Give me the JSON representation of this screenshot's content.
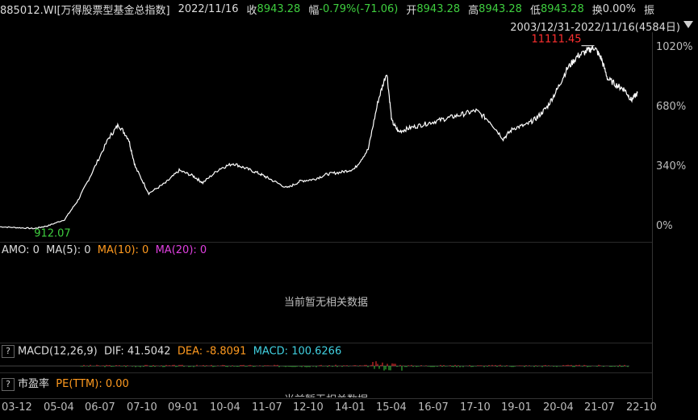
{
  "header": {
    "code_name": "885012.WI[万得股票型基金总指数]",
    "date": "2022/11/16",
    "close_label": "收",
    "close_value": "8943.28",
    "change_label": "幅",
    "change_value": "-0.79%(-71.06)",
    "open_label": "开",
    "open_value": "8943.28",
    "high_label": "高",
    "high_value": "8943.28",
    "low_label": "低",
    "low_value": "8943.28",
    "turnover_label": "换",
    "turnover_value": "0.00%",
    "amplitude_label": "振"
  },
  "range": {
    "text": "2003/12/31-2022/11/16(4584日)"
  },
  "chart_data": {
    "type": "line",
    "x_tick_labels": [
      "03-12",
      "05-04",
      "06-07",
      "07-10",
      "09-01",
      "10-04",
      "11-07",
      "12-10",
      "14-01",
      "15-04",
      "16-07",
      "17-10",
      "19-01",
      "20-04",
      "21-07",
      "22-10"
    ],
    "x": [
      2003.99,
      2004.5,
      2005.0,
      2005.4,
      2005.9,
      2006.3,
      2006.7,
      2007.2,
      2007.5,
      2007.8,
      2008.0,
      2008.4,
      2008.9,
      2009.3,
      2009.7,
      2010.0,
      2010.5,
      2010.9,
      2011.3,
      2011.7,
      2012.0,
      2012.5,
      2012.9,
      2013.3,
      2013.7,
      2014.1,
      2014.5,
      2014.9,
      2015.2,
      2015.45,
      2015.6,
      2015.8,
      2016.1,
      2016.5,
      2016.9,
      2017.3,
      2017.7,
      2018.1,
      2018.5,
      2018.9,
      2019.2,
      2019.6,
      2019.9,
      2020.2,
      2020.5,
      2020.8,
      2021.1,
      2021.4,
      2021.6,
      2021.8,
      2022.0,
      2022.3,
      2022.5,
      2022.7,
      2022.88
    ],
    "y": [
      0,
      -5,
      -10,
      5,
      40,
      150,
      300,
      500,
      580,
      500,
      340,
      190,
      250,
      320,
      290,
      250,
      330,
      360,
      330,
      300,
      270,
      220,
      260,
      270,
      300,
      310,
      330,
      440,
      720,
      880,
      600,
      540,
      560,
      580,
      600,
      620,
      640,
      660,
      600,
      500,
      560,
      580,
      620,
      680,
      780,
      900,
      970,
      1000,
      1020,
      960,
      840,
      800,
      780,
      720,
      760
    ],
    "y_tick_labels": [
      "1020%",
      "680%",
      "340%",
      "0%"
    ],
    "ylim": [
      -40,
      1060
    ],
    "annotations": [
      {
        "text": "11111.45",
        "color": "#ff3030"
      },
      {
        "text": "912.07",
        "color": "#3fcf3f"
      }
    ],
    "grid": false
  },
  "amo": {
    "label_amo": "AMO: 0",
    "label_ma5": "MA(5): 0",
    "label_ma10": "MA(10): 0",
    "label_ma20": "MA(20): 0",
    "no_data": "当前暂无相关数据"
  },
  "macd": {
    "help": "?",
    "label": "MACD(12,26,9)",
    "dif": "DIF: 41.5042",
    "dea": "DEA: -8.8091",
    "macd": "MACD: 100.6266"
  },
  "pe": {
    "help": "?",
    "label": "市盈率",
    "ttm": "PE(TTM): 0.00",
    "no_data": "当前暂无相关数据"
  },
  "colors": {
    "up": "#3fcf3f",
    "down": "#ff3030",
    "ma10": "#ff9a1f",
    "ma20": "#e040e0",
    "macd": "#40d0e0"
  }
}
